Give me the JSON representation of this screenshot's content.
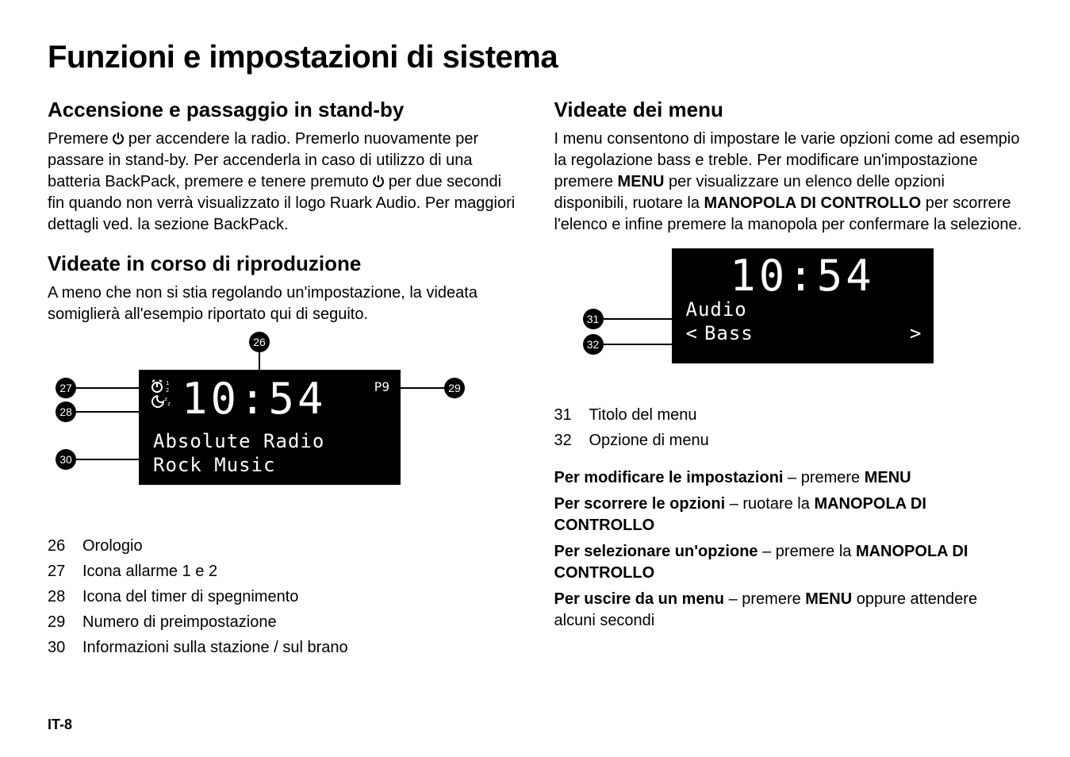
{
  "title": "Funzioni e impostazioni di sistema",
  "page_number": "IT-8",
  "left": {
    "h2_1": "Accensione e passaggio in stand-by",
    "p1a": "Premere ",
    "p1b": " per accendere la radio. Premerlo nuovamente per passare in stand-by. Per accenderla in caso di utilizzo di una batteria BackPack, premere e tenere premuto ",
    "p1c": " per due secondi fin quando non verrà visualizzato il logo Ruark Audio. Per maggiori dettagli ved. la sezione BackPack.",
    "h2_2": "Videate in corso di riproduzione",
    "p2": "A meno che non si stia regolando un'impostazione, la videata somiglierà all'esempio riportato qui di seguito.",
    "lcd": {
      "clock": "10:54",
      "preset": "P9",
      "station": "Absolute Radio",
      "genre": "Rock Music"
    },
    "callouts": {
      "26": "26",
      "27": "27",
      "28": "28",
      "29": "29",
      "30": "30"
    },
    "legend": [
      {
        "num": "26",
        "text": "Orologio"
      },
      {
        "num": "27",
        "text": "Icona allarme 1 e 2"
      },
      {
        "num": "28",
        "text": "Icona del timer di spegnimento"
      },
      {
        "num": "29",
        "text": "Numero di preimpostazione"
      },
      {
        "num": "30",
        "text": "Informazioni sulla stazione / sul brano"
      }
    ]
  },
  "right": {
    "h2_1": "Videate dei menu",
    "p1a": "I menu consentono di impostare le varie opzioni come ad esempio la regolazione bass e treble. Per modificare un'impostazione premere ",
    "p1_menu": "MENU",
    "p1b": " per visualizzare un elenco delle opzioni disponibili, ruotare la ",
    "p1_knob": "MANOPOLA DI CONTROLLO",
    "p1c": " per scorrere l'elenco e infine premere la manopola per confermare la selezione.",
    "lcd2": {
      "clock": "10:54",
      "title": "Audio",
      "option_prefix": "<",
      "option": "Bass",
      "arrow": ">"
    },
    "callouts": {
      "31": "31",
      "32": "32"
    },
    "legend": [
      {
        "num": "31",
        "text": "Titolo del menu"
      },
      {
        "num": "32",
        "text": "Opzione di menu"
      }
    ],
    "instr": [
      {
        "b": "Per modificare le impostazioni",
        "mid": " – premere ",
        "b2": "MENU",
        "tail": ""
      },
      {
        "b": "Per scorrere le opzioni",
        "mid": " – ruotare la ",
        "b2": "MANOPOLA DI CONTROLLO",
        "tail": ""
      },
      {
        "b": "Per selezionare un'opzione",
        "mid": " – premere la ",
        "b2": "MANOPOLA DI CONTROLLO",
        "tail": ""
      },
      {
        "b": "Per uscire da un menu",
        "mid": " – premere ",
        "b2": "MENU",
        "tail": " oppure attendere alcuni secondi"
      }
    ]
  }
}
